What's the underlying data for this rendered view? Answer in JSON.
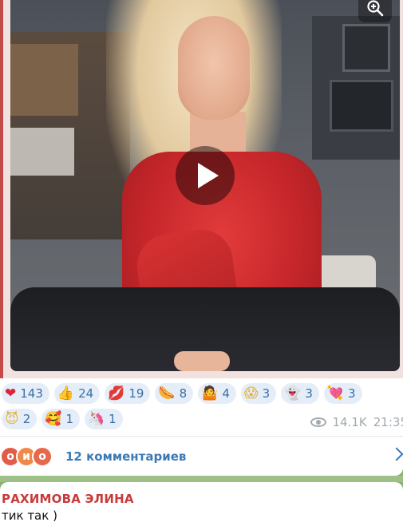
{
  "post": {
    "media": {
      "kind": "video",
      "description_icon": "play-icon"
    },
    "zoom_icon": "zoom-in-icon",
    "reactions": [
      {
        "emoji": "❤",
        "count": "143",
        "color": "#d9263a"
      },
      {
        "emoji": "👍",
        "count": "24",
        "color": "#e8b23c"
      },
      {
        "emoji": "💋",
        "count": "19",
        "color": "#d62e4b"
      },
      {
        "emoji": "🌭",
        "count": "8",
        "color": "#d77a2e"
      },
      {
        "emoji": "🤷",
        "count": "4",
        "color": "#8a3bb8"
      },
      {
        "emoji": "😱",
        "count": "3",
        "color": "#e7b33c"
      },
      {
        "emoji": "👻",
        "count": "3",
        "color": "#b8bcc4"
      },
      {
        "emoji": "💘",
        "count": "3",
        "color": "#d3386a"
      },
      {
        "emoji": "😈",
        "count": "2",
        "color": "#e7b33c"
      },
      {
        "emoji": "🥰",
        "count": "1",
        "color": "#e7b33c"
      },
      {
        "emoji": "🦄",
        "count": "1",
        "color": "#c07ad6"
      }
    ],
    "views": "14.1K",
    "time": "21:35"
  },
  "comments_bar": {
    "avatars": [
      {
        "letter": "о",
        "color": "#e25c4a"
      },
      {
        "letter": "и",
        "color": "#f0884a"
      },
      {
        "letter": "о",
        "color": "#e7694b"
      }
    ],
    "label": "12 комментариев"
  },
  "next_message": {
    "author": "РАХИМОВА ЭЛИНА",
    "text": "тик так )"
  },
  "colors": {
    "accent": "#3a79b5",
    "reaction_bg": "#e5eef8",
    "author": "#c73b3b",
    "frame": "#c24a48"
  }
}
